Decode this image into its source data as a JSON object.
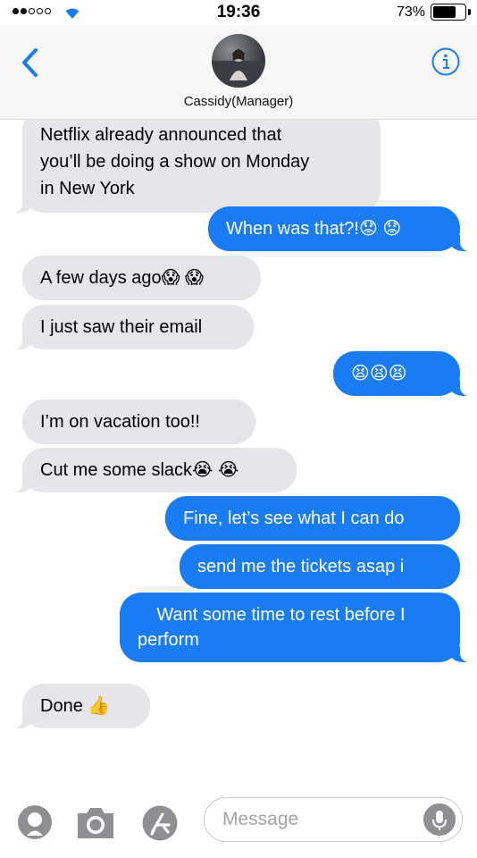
{
  "status_bar": {
    "time": "19:36",
    "battery_percent": "73%",
    "battery_level": 0.73
  },
  "header": {
    "contact_name": "Cassidy(Manager)"
  },
  "messages": [
    {
      "from": "them",
      "text": "Netflix already announced that you’ll be doing a show on Monday in New York",
      "lines": [
        "Netflix already announced that",
        "you’ll be doing a show on Monday",
        "in New York"
      ]
    },
    {
      "from": "me",
      "text": "When was that?!😟 😟"
    },
    {
      "from": "them",
      "text": "A few days ago😱 😱"
    },
    {
      "from": "them",
      "text": "I just saw their email"
    },
    {
      "from": "me",
      "text": "😫😫😫"
    },
    {
      "from": "them",
      "text": "I’m on vacation too!!"
    },
    {
      "from": "them",
      "text": "Cut me some slack😭 😭"
    },
    {
      "from": "me",
      "text": "Fine, let’s see what I can do"
    },
    {
      "from": "me",
      "text": "send me the tickets asap i"
    },
    {
      "from": "me",
      "text": "Want some time to rest before I perform",
      "lines": [
        "Want some time to rest before I",
        "perform"
      ]
    },
    {
      "from": "them",
      "text": "Done 👍"
    }
  ],
  "input": {
    "placeholder": "Message"
  },
  "colors": {
    "outgoing_bubble": "#1a7cf3",
    "incoming_bubble": "#e5e5ea",
    "accent": "#1a7cf3"
  },
  "icons": [
    "back-chevron-icon",
    "info-icon",
    "wifi-icon",
    "memoji-icon",
    "camera-icon",
    "app-store-icon",
    "microphone-icon"
  ]
}
